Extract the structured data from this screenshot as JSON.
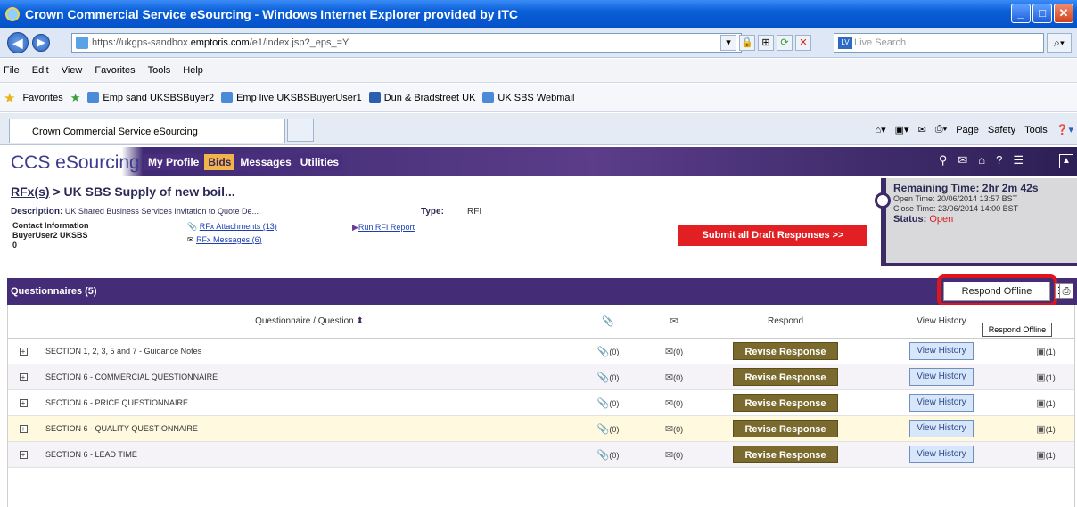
{
  "window": {
    "title": "Crown Commercial Service eSourcing - Windows Internet Explorer provided by ITC"
  },
  "address": {
    "url_prefix": "https://ukgps-sandbox.",
    "url_domain": "emptoris.com",
    "url_suffix": "/e1/index.jsp?_eps_=Y",
    "search_placeholder": "Live Search"
  },
  "menu": [
    "File",
    "Edit",
    "View",
    "Favorites",
    "Tools",
    "Help"
  ],
  "favorites": {
    "label": "Favorites",
    "items": [
      "Emp sand UKSBSBuyer2",
      "Emp live UKSBSBuyerUser1",
      "Dun & Bradstreet UK",
      "UK SBS Webmail"
    ]
  },
  "tab": {
    "label": "Crown Commercial Service eSourcing"
  },
  "commandbar": {
    "page": "Page",
    "safety": "Safety",
    "tools": "Tools"
  },
  "app": {
    "brand": "CCS eSourcing",
    "nav": [
      "My Profile",
      "Bids",
      "Messages",
      "Utilities"
    ]
  },
  "breadcrumb": {
    "link": "RFx(s)",
    "sep": ">",
    "title": "UK SBS Supply of new boil..."
  },
  "details": {
    "description_label": "Description:",
    "description": "UK Shared Business Services Invitation to Quote De...",
    "contact_label": "Contact Information",
    "contact_name": "BuyerUser2 UKSBS",
    "contact_extra": "0",
    "attachments": "RFx Attachments (13)",
    "messages": "RFx Messages (6)",
    "type_label": "Type:",
    "type_value": "RFI",
    "report": "Run RFI Report",
    "submit": "Submit all Draft Responses >>"
  },
  "timer": {
    "remaining": "Remaining Time: 2hr 2m 42s",
    "open": "Open Time: 20/06/2014 13:57 BST",
    "close": "Close Time: 23/06/2014 14:00 BST",
    "status_label": "Status:",
    "status_value": "Open"
  },
  "questionnaires": {
    "title": "Questionnaires (5)",
    "respond_offline": "Respond Offline",
    "tooltip": "Respond Offline",
    "headers": {
      "question": "Questionnaire / Question",
      "respond": "Respond",
      "history": "View History"
    },
    "rows": [
      {
        "name": "SECTION 1, 2, 3, 5 and 7 - Guidance Notes",
        "attach": "(0)",
        "msg": "(0)",
        "respond": "Revise Response",
        "history": "View History",
        "count": "(1)"
      },
      {
        "name": "SECTION 6 - COMMERCIAL QUESTIONNAIRE",
        "attach": "(0)",
        "msg": "(0)",
        "respond": "Revise Response",
        "history": "View History",
        "count": "(1)"
      },
      {
        "name": "SECTION 6 - PRICE QUESTIONNAIRE",
        "attach": "(0)",
        "msg": "(0)",
        "respond": "Revise Response",
        "history": "View History",
        "count": "(1)"
      },
      {
        "name": "SECTION 6 - QUALITY QUESTIONNAIRE",
        "attach": "(0)",
        "msg": "(0)",
        "respond": "Revise Response",
        "history": "View History",
        "count": "(1)"
      },
      {
        "name": "SECTION 6 - LEAD TIME",
        "attach": "(0)",
        "msg": "(0)",
        "respond": "Revise Response",
        "history": "View History",
        "count": "(1)"
      }
    ]
  }
}
